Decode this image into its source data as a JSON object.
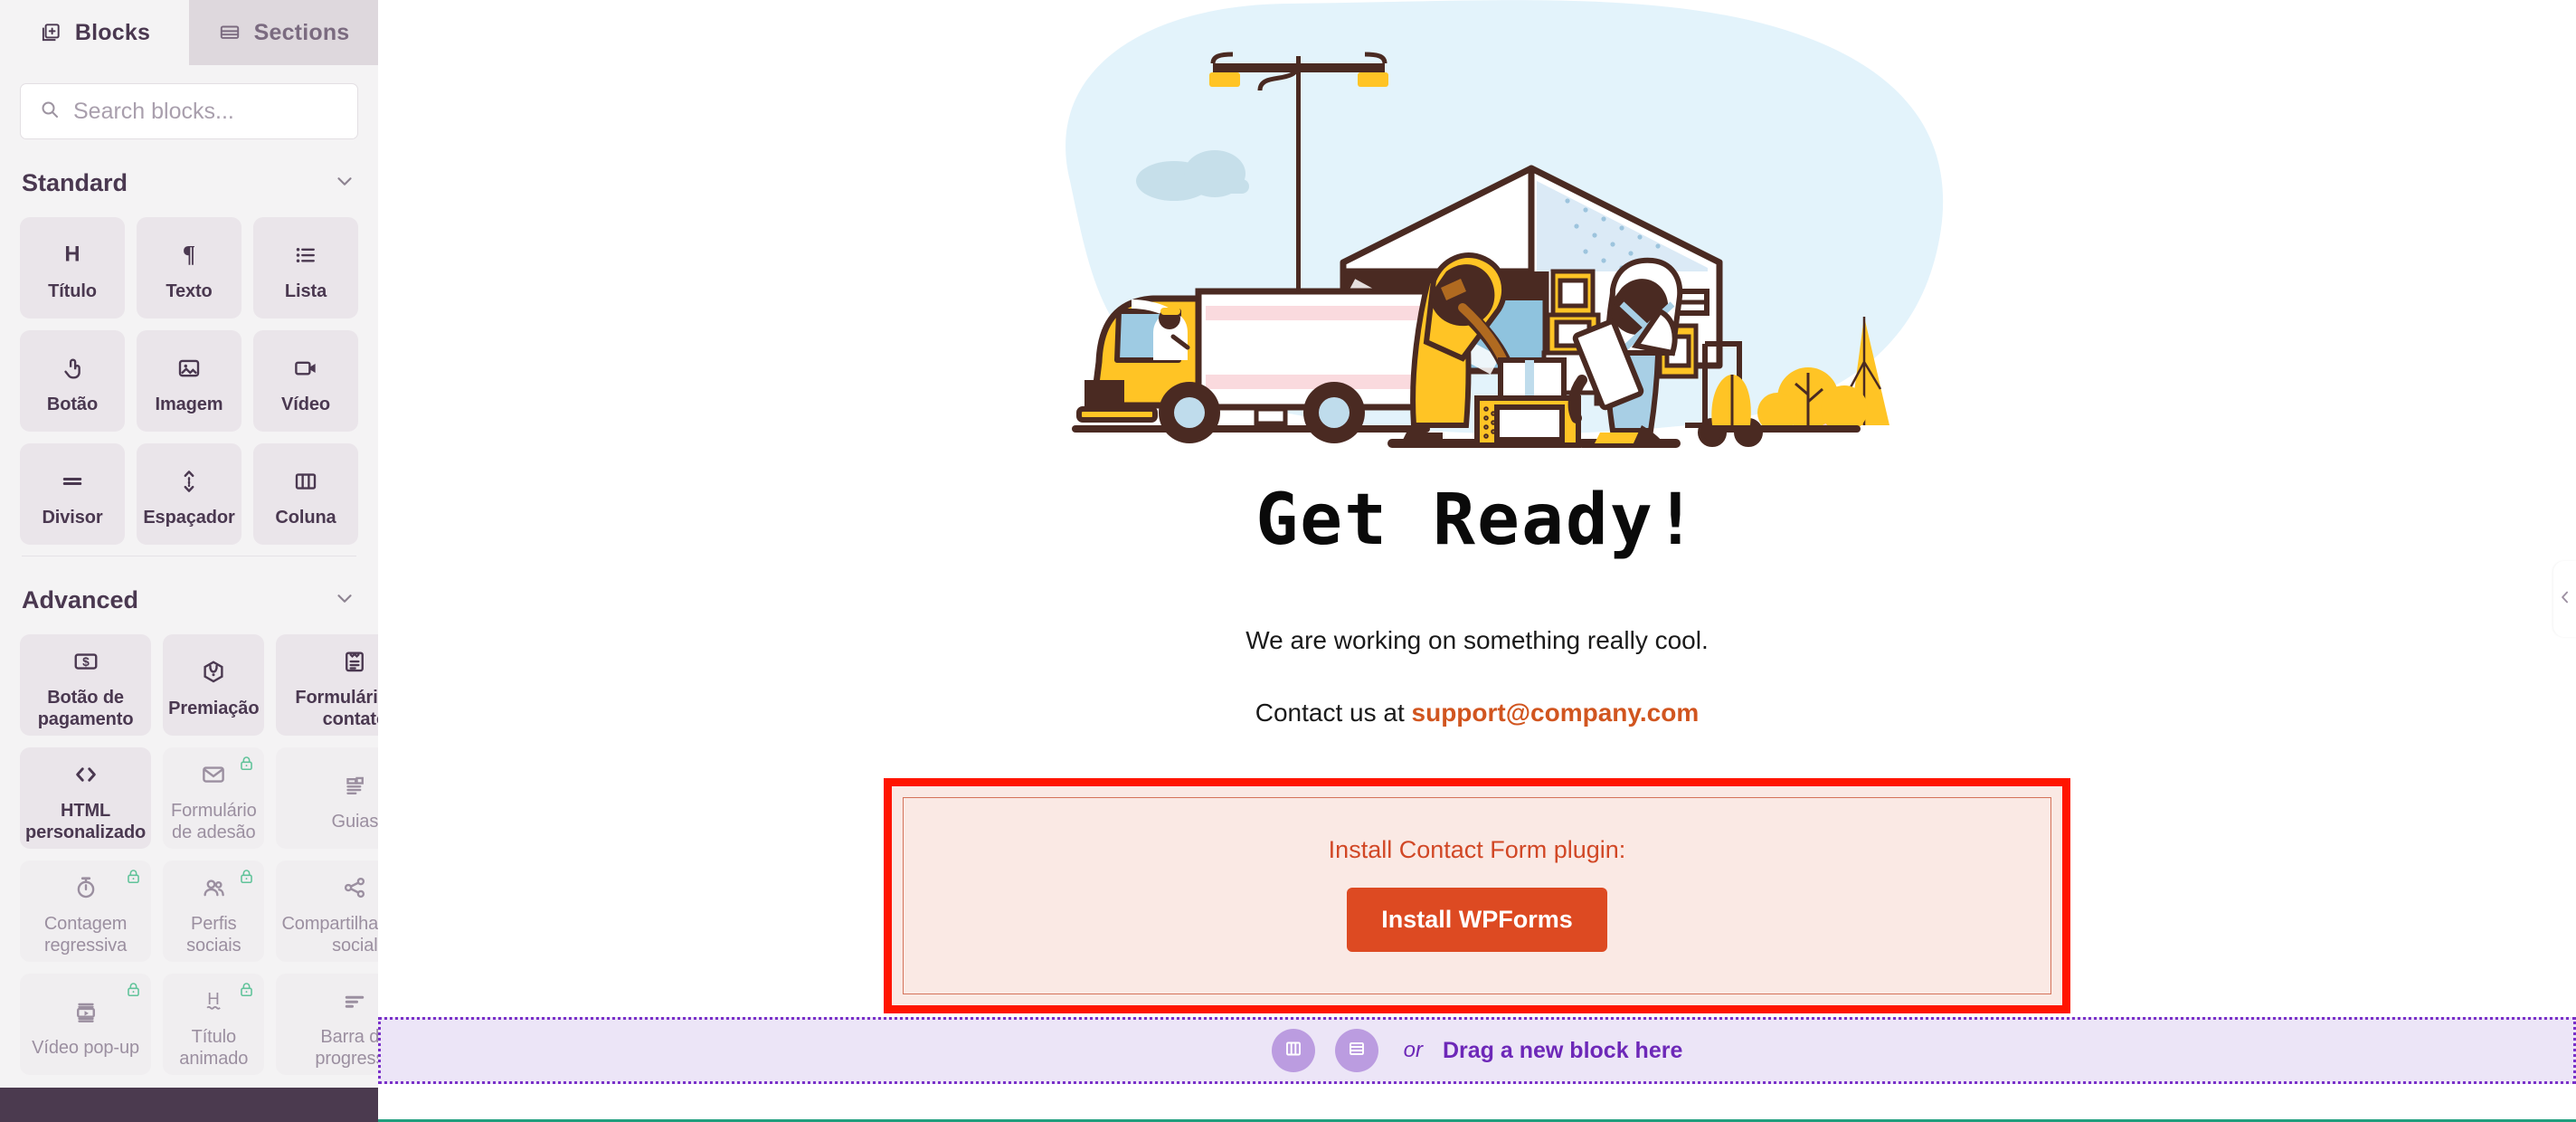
{
  "sidebar": {
    "tabs": [
      {
        "label": "Blocks",
        "icon": "blocks-icon",
        "active": true
      },
      {
        "label": "Sections",
        "icon": "sections-icon",
        "active": false
      }
    ],
    "search": {
      "placeholder": "Search blocks...",
      "value": "",
      "icon": "search-icon"
    },
    "sections": [
      {
        "title": "Standard",
        "collapse_icon": "chevron-down-icon",
        "blocks": [
          {
            "label": "Título",
            "icon": "heading-icon",
            "locked": false
          },
          {
            "label": "Texto",
            "icon": "paragraph-icon",
            "locked": false
          },
          {
            "label": "Lista",
            "icon": "list-icon",
            "locked": false
          },
          {
            "label": "Botão",
            "icon": "click-button-icon",
            "locked": false
          },
          {
            "label": "Imagem",
            "icon": "image-icon",
            "locked": false
          },
          {
            "label": "Vídeo",
            "icon": "video-camera-icon",
            "locked": false
          },
          {
            "label": "Divisor",
            "icon": "divider-icon",
            "locked": false
          },
          {
            "label": "Espaçador",
            "icon": "spacer-arrows-icon",
            "locked": false
          },
          {
            "label": "Coluna",
            "icon": "columns-icon",
            "locked": false
          }
        ]
      },
      {
        "title": "Advanced",
        "collapse_icon": "chevron-down-icon",
        "blocks": [
          {
            "label": "Botão de pagamento",
            "icon": "payment-card-icon",
            "locked": false
          },
          {
            "label": "Premiação",
            "icon": "award-hexagon-icon",
            "locked": false
          },
          {
            "label": "Formulário de contato",
            "icon": "contact-form-icon",
            "locked": false
          },
          {
            "label": "HTML personalizado",
            "icon": "code-brackets-icon",
            "locked": false
          },
          {
            "label": "Formulário de adesão",
            "icon": "envelope-icon",
            "locked": true
          },
          {
            "label": "Guias",
            "icon": "tabs-icon",
            "locked": true
          },
          {
            "label": "Contagem regressiva",
            "icon": "stopwatch-icon",
            "locked": true
          },
          {
            "label": "Perfis sociais",
            "icon": "people-icon",
            "locked": true
          },
          {
            "label": "Compartilhamento social",
            "icon": "share-icon",
            "locked": true
          },
          {
            "label": "Vídeo pop-up",
            "icon": "video-popup-icon",
            "locked": true
          },
          {
            "label": "Título animado",
            "icon": "animated-heading-icon",
            "locked": true
          },
          {
            "label": "Barra de progresso",
            "icon": "progress-bar-icon",
            "locked": true
          }
        ]
      }
    ],
    "collapse_handle_icon": "chevron-left-icon"
  },
  "canvas": {
    "illustration": "warehouse-delivery-illustration",
    "title": "Get Ready!",
    "subtitle": "We are working on something really cool.",
    "contact_prefix": "Contact us at ",
    "contact_email": "support@company.com",
    "install_notice": {
      "label": "Install Contact Form plugin:",
      "button_label": "Install WPForms",
      "highlight_color": "#ff1500",
      "button_color": "#dd4a22"
    },
    "dropzone": {
      "column_icon": "columns-icon",
      "section_icon": "section-icon",
      "or_label": "or",
      "text": "Drag a new block here",
      "accent_color": "#6d28b8"
    }
  }
}
